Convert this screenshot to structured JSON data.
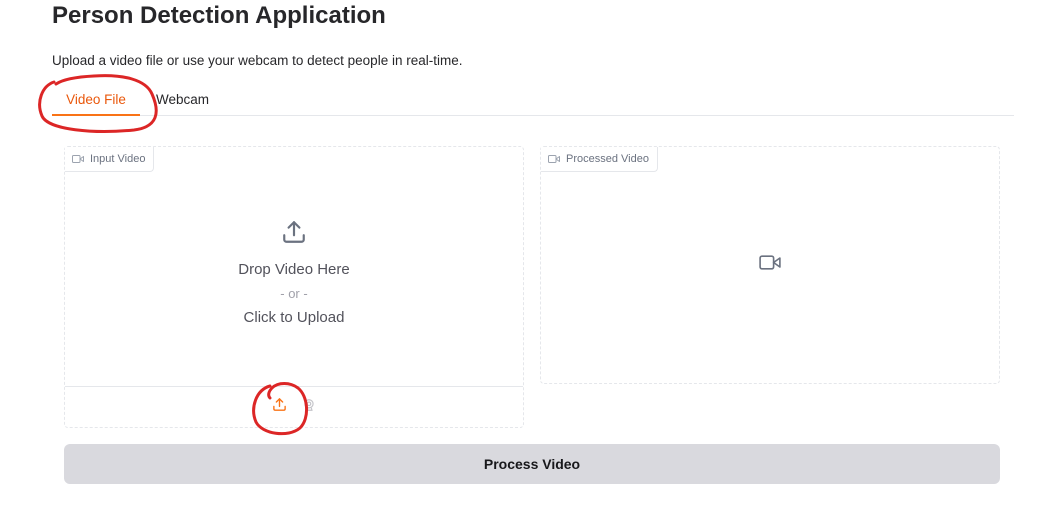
{
  "header": {
    "title": "Person Detection Application",
    "subtitle": "Upload a video file or use your webcam to detect people in real-time."
  },
  "tabs": [
    {
      "label": "Video File",
      "active": true
    },
    {
      "label": "Webcam",
      "active": false
    }
  ],
  "input_panel": {
    "label": "Input Video",
    "label_icon": "video-camera-icon",
    "drop_text": "Drop Video Here",
    "or_text": "- or -",
    "click_text": "Click to Upload",
    "toolbar_icons": [
      "upload-icon",
      "webcam-icon"
    ]
  },
  "output_panel": {
    "label": "Processed Video",
    "label_icon": "video-camera-icon",
    "placeholder_icon": "video-camera-icon"
  },
  "process_button": {
    "label": "Process Video"
  },
  "colors": {
    "accent": "#f97316",
    "annotation": "#dc2626",
    "button_bg": "#d9d9de"
  }
}
